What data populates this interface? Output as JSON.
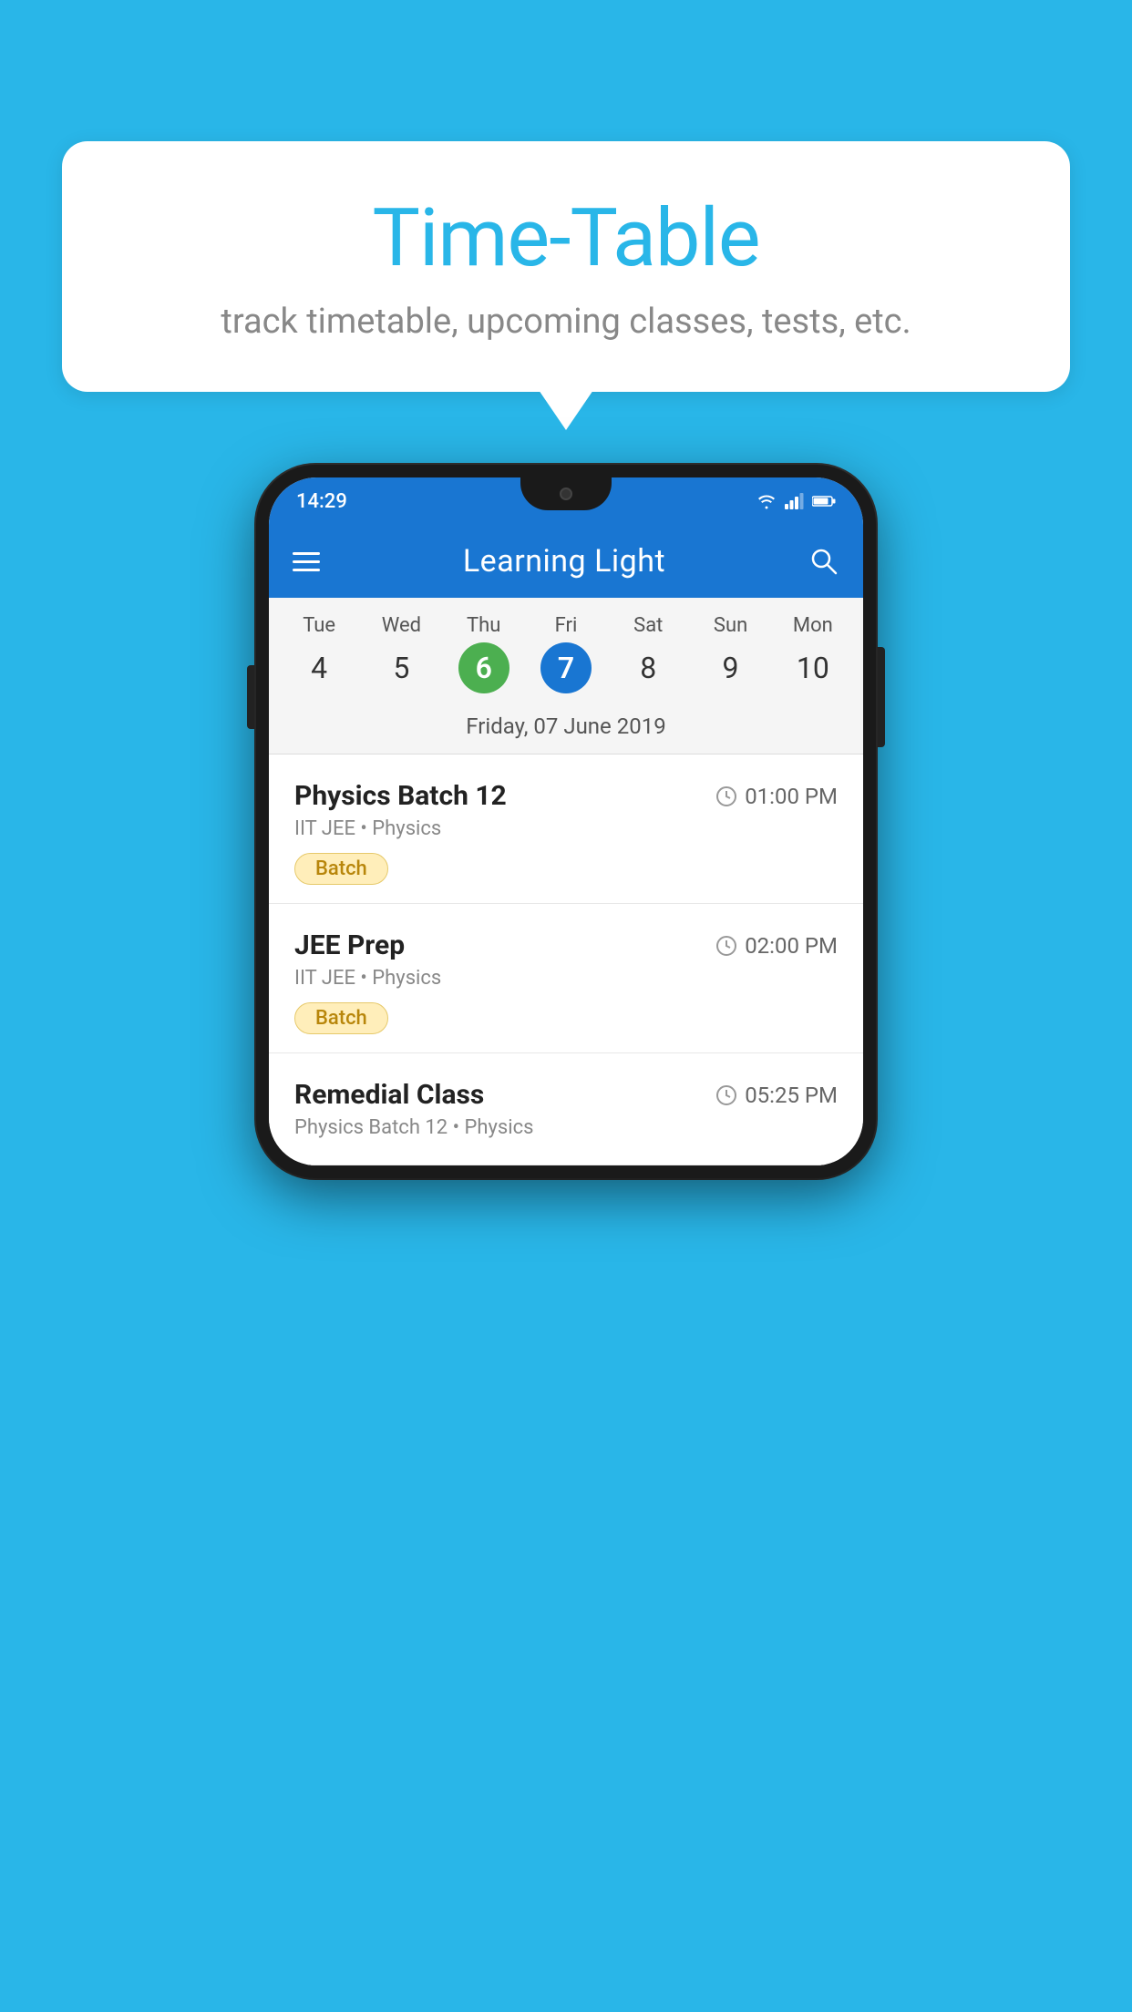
{
  "background_color": "#29b6e8",
  "header": {
    "title": "Time-Table",
    "subtitle": "track timetable, upcoming classes, tests, etc."
  },
  "phone": {
    "status_bar": {
      "time": "14:29",
      "icons": [
        "wifi",
        "signal",
        "battery"
      ]
    },
    "app_bar": {
      "title": "Learning Light"
    },
    "calendar": {
      "days": [
        {
          "label": "Tue",
          "number": "4",
          "state": "normal"
        },
        {
          "label": "Wed",
          "number": "5",
          "state": "normal"
        },
        {
          "label": "Thu",
          "number": "6",
          "state": "today"
        },
        {
          "label": "Fri",
          "number": "7",
          "state": "selected"
        },
        {
          "label": "Sat",
          "number": "8",
          "state": "normal"
        },
        {
          "label": "Sun",
          "number": "9",
          "state": "normal"
        },
        {
          "label": "Mon",
          "number": "10",
          "state": "normal"
        }
      ],
      "selected_date_label": "Friday, 07 June 2019"
    },
    "schedule": [
      {
        "title": "Physics Batch 12",
        "time": "01:00 PM",
        "subtitle": "IIT JEE • Physics",
        "badge": "Batch"
      },
      {
        "title": "JEE Prep",
        "time": "02:00 PM",
        "subtitle": "IIT JEE • Physics",
        "badge": "Batch"
      },
      {
        "title": "Remedial Class",
        "time": "05:25 PM",
        "subtitle": "Physics Batch 12 • Physics",
        "badge": null,
        "partial": true
      }
    ]
  }
}
